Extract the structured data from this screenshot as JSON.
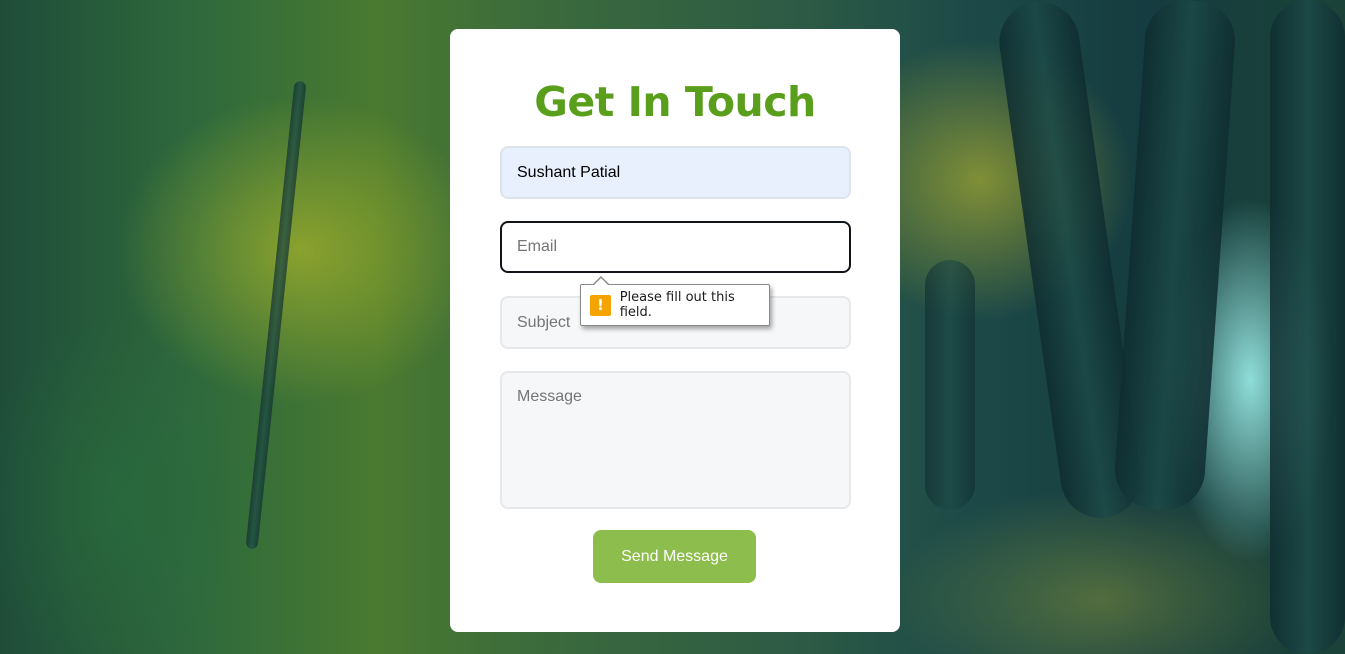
{
  "form": {
    "title": "Get In Touch",
    "name_value": "Sushant Patial",
    "email_placeholder": "Email",
    "subject_placeholder": "Subject",
    "message_placeholder": "Message",
    "send_label": "Send Message"
  },
  "validation_tooltip": {
    "icon": "warning-icon",
    "icon_glyph": "!",
    "message": "Please fill out this field."
  },
  "colors": {
    "title": "#5a9f1c",
    "send_button": "#8dbd4c",
    "name_autofill_bg": "#e8f0fe",
    "warning": "#f5a300"
  }
}
